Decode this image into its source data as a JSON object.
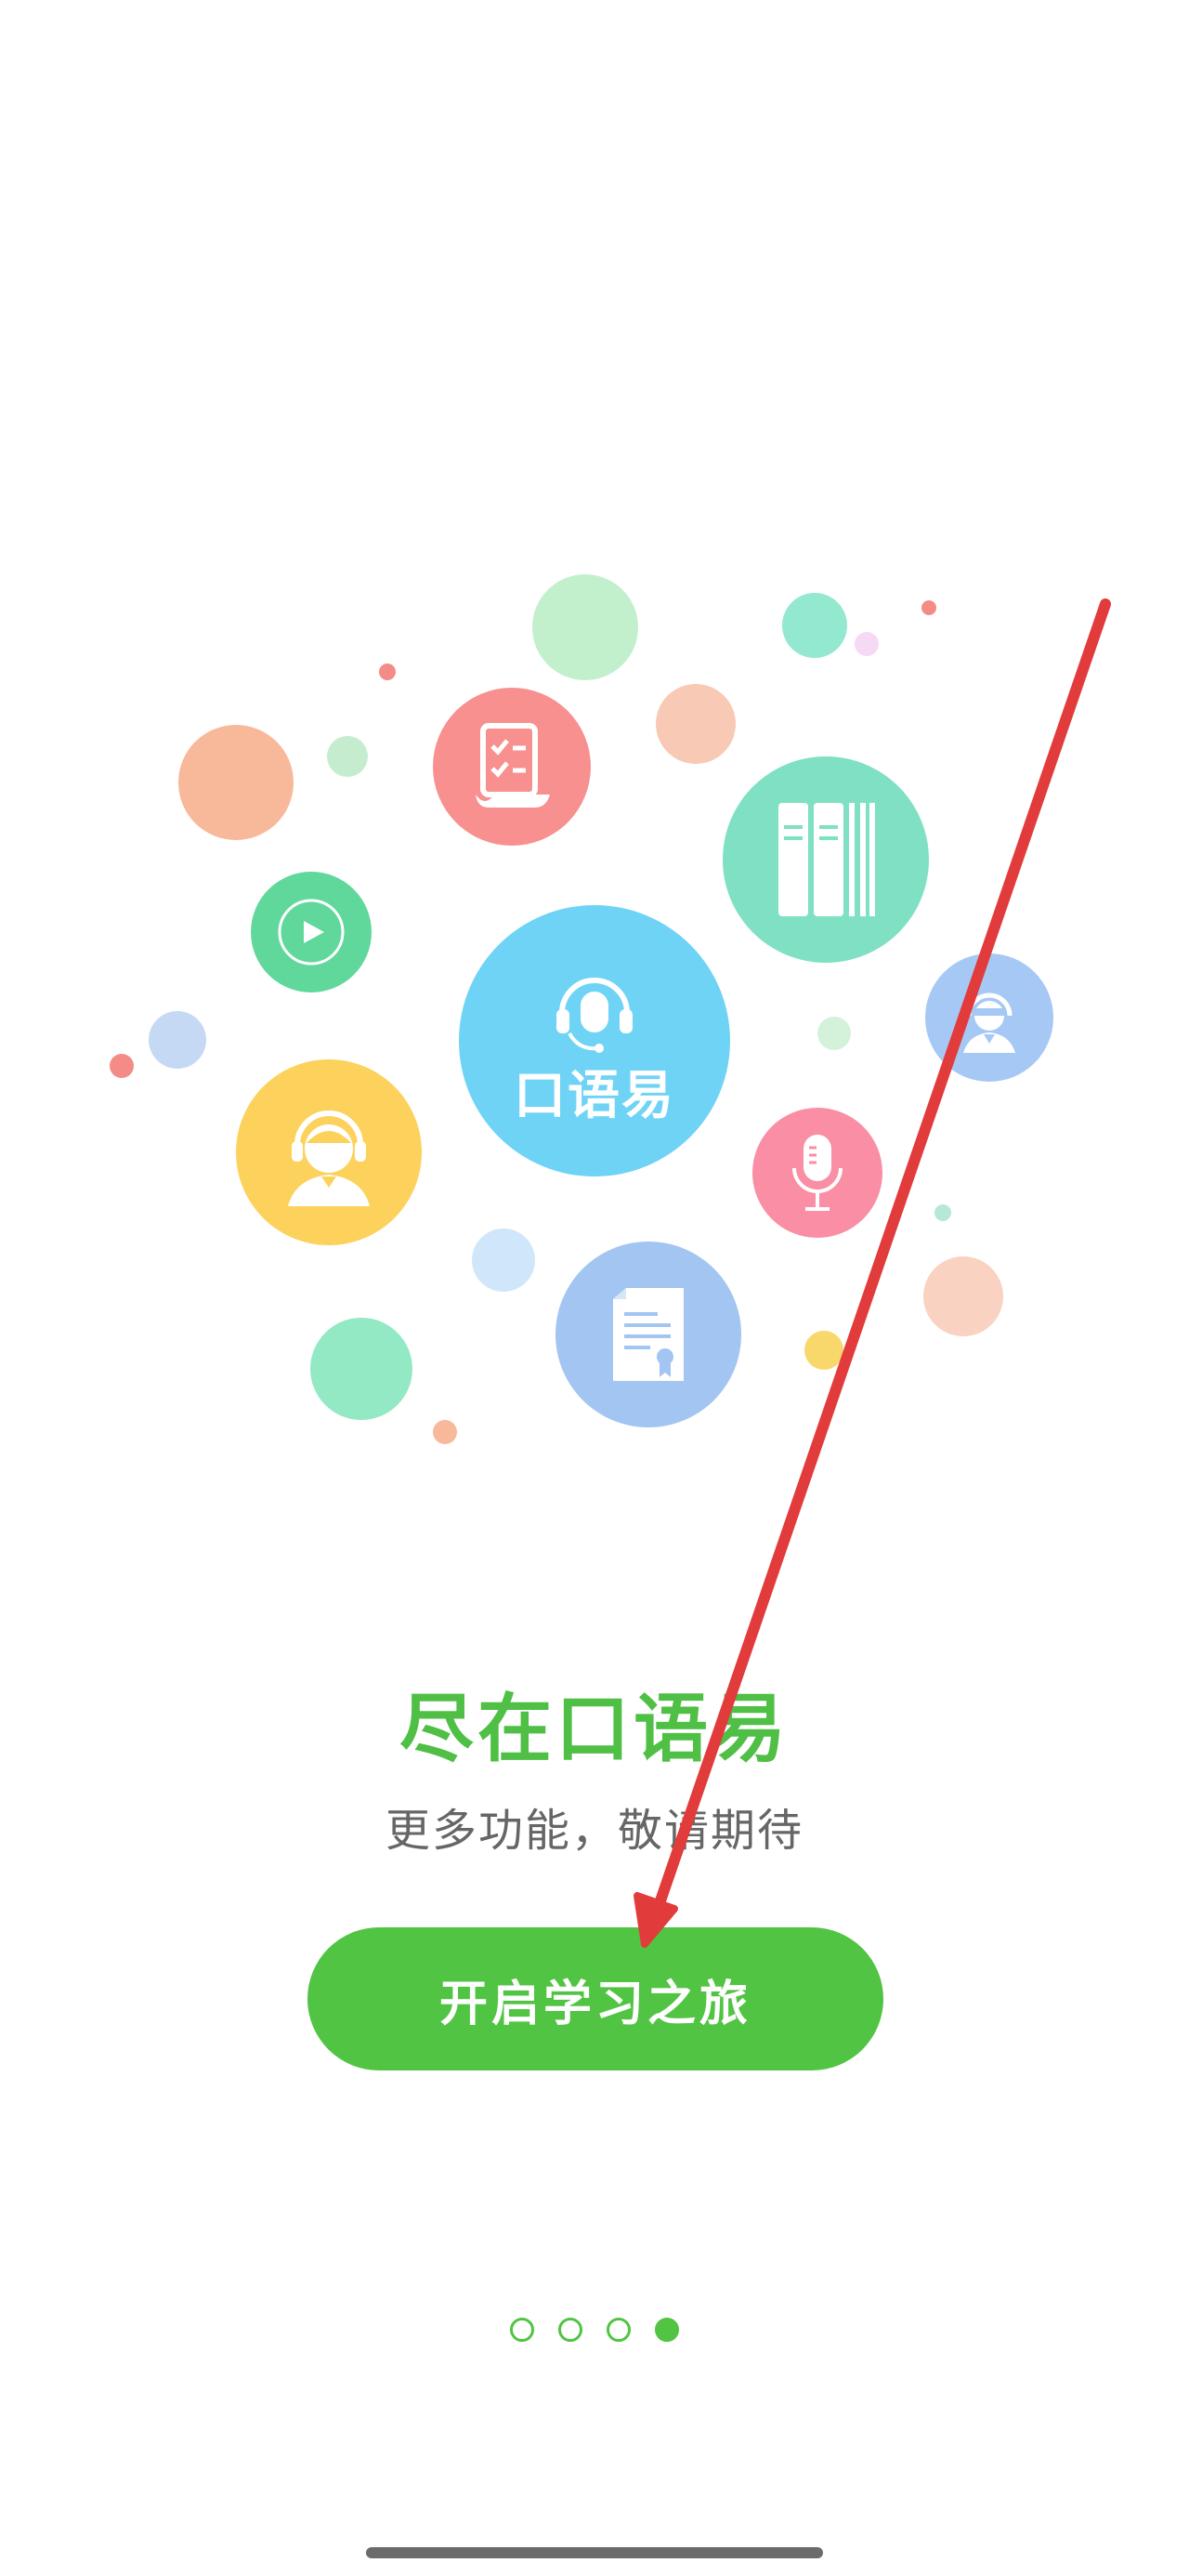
{
  "illustration": {
    "center_logo_text": "口语易",
    "icons": [
      "headset-logo-icon",
      "checklist-icon",
      "books-icon",
      "play-icon",
      "user-headset-icon",
      "student-icon",
      "microphone-icon",
      "certificate-icon"
    ]
  },
  "headline": "尽在口语易",
  "subline": "更多功能，敬请期待",
  "cta_label": "开启学习之旅",
  "pager": {
    "total": 4,
    "active_index": 3
  },
  "colors": {
    "brand_green": "#52c443",
    "headline_green": "#4fbf45",
    "subtext_gray": "#666666",
    "annotation_red": "#e23b3b"
  }
}
